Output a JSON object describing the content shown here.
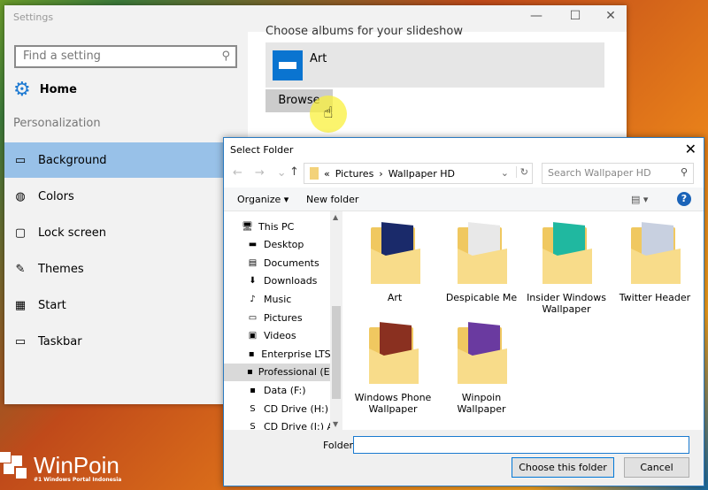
{
  "settings": {
    "title": "Settings",
    "controls": [
      "—",
      "☐",
      "✕"
    ],
    "search_placeholder": "Find a setting",
    "home": "Home",
    "section": "Personalization",
    "nav": [
      {
        "label": "Background",
        "icon": "image-icon",
        "glyph": "▭",
        "selected": true
      },
      {
        "label": "Colors",
        "icon": "palette-icon",
        "glyph": "◍"
      },
      {
        "label": "Lock screen",
        "icon": "lock-screen-icon",
        "glyph": "▢"
      },
      {
        "label": "Themes",
        "icon": "themes-icon",
        "glyph": "✎"
      },
      {
        "label": "Start",
        "icon": "start-icon",
        "glyph": "▦"
      },
      {
        "label": "Taskbar",
        "icon": "taskbar-icon",
        "glyph": "▭"
      }
    ],
    "content": {
      "heading": "Choose albums for your slideshow",
      "album": "Art",
      "browse": "Browse"
    }
  },
  "dialog": {
    "title": "Select Folder",
    "close": "✕",
    "breadcrumb": [
      "«",
      "Pictures",
      "›",
      "Wallpaper HD"
    ],
    "search_placeholder": "Search Wallpaper HD",
    "organize": "Organize ▾",
    "new_folder": "New folder",
    "tree": [
      {
        "label": "This PC",
        "glyph": "🖥"
      },
      {
        "label": "Desktop",
        "glyph": "▬"
      },
      {
        "label": "Documents",
        "glyph": "▤"
      },
      {
        "label": "Downloads",
        "glyph": "⬇"
      },
      {
        "label": "Music",
        "glyph": "♪"
      },
      {
        "label": "Pictures",
        "glyph": "▭"
      },
      {
        "label": "Videos",
        "glyph": "▣"
      },
      {
        "label": "Enterprise LTSB (",
        "glyph": "▪"
      },
      {
        "label": "Professional (E:)",
        "glyph": "▪",
        "selected": true
      },
      {
        "label": "Data (F:)",
        "glyph": "▪"
      },
      {
        "label": "CD Drive (H:) An",
        "glyph": "S"
      },
      {
        "label": "CD Drive (I:) Ar",
        "glyph": "S"
      }
    ],
    "folders": [
      {
        "label": "Art",
        "color": "#1a2a6a"
      },
      {
        "label": "Despicable Me",
        "color": "#e8e8e8"
      },
      {
        "label": "Insider Windows Wallpaper",
        "color": "#20b8a0"
      },
      {
        "label": "Twitter Header",
        "color": "#c8d0e0"
      },
      {
        "label": "Windows Phone Wallpaper",
        "color": "#8a3020"
      },
      {
        "label": "Winpoin Wallpaper",
        "color": "#6a3aa0"
      }
    ],
    "folder_label": "Folder:",
    "folder_value": "",
    "choose": "Choose this folder",
    "cancel": "Cancel"
  },
  "watermark": {
    "name": "WinPoin",
    "tagline": "#1 Windows Portal Indonesia"
  }
}
